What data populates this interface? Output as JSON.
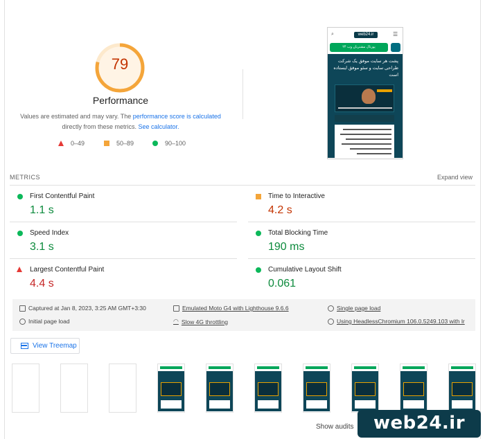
{
  "summary": {
    "score": "79",
    "title": "Performance",
    "desc_part1": "Values are estimated and may vary. The ",
    "desc_link1": "performance score is calculated",
    "desc_part2": " directly from these metrics. ",
    "desc_link2": "See calculator.",
    "score_fraction": 0.79,
    "legend": [
      {
        "shape": "triangle",
        "range": "0–49",
        "color": "#e53935"
      },
      {
        "shape": "square",
        "range": "50–89",
        "color": "#f4a53a"
      },
      {
        "shape": "circle",
        "range": "90–100",
        "color": "#0cb85a"
      }
    ]
  },
  "screenshot": {
    "logo": "web24.ir",
    "button_text": "پورتال مشتریان وب ۲۴",
    "hero_text": "پشت هر سایت موفق یک شرکت طراحی سایت و سئو موفق ایستاده است"
  },
  "metrics": {
    "label": "METRICS",
    "expand": "Expand view",
    "items": [
      {
        "name": "First Contentful Paint",
        "value": "1.1 s",
        "status": "pass"
      },
      {
        "name": "Time to Interactive",
        "value": "4.2 s",
        "status": "average"
      },
      {
        "name": "Speed Index",
        "value": "3.1 s",
        "status": "pass"
      },
      {
        "name": "Total Blocking Time",
        "value": "190 ms",
        "status": "pass"
      },
      {
        "name": "Largest Contentful Paint",
        "value": "4.4 s",
        "status": "fail"
      },
      {
        "name": "Cumulative Layout Shift",
        "value": "0.061",
        "status": "pass"
      }
    ]
  },
  "info": {
    "captured": "Captured at Jan 8, 2023, 3:25 AM GMT+3:30",
    "device": "Emulated Moto G4 with Lighthouse 9.6.6",
    "single": "Single page load",
    "initial": "Initial page load",
    "throttling": "Slow 4G throttling",
    "browser": "Using HeadlessChromium 106.0.5249.103 with lr"
  },
  "treemap": {
    "label": "View Treemap"
  },
  "filmstrip": {
    "blank_frames": 3,
    "content_frames": 7
  },
  "footer": {
    "show_audits": "Show audits"
  },
  "watermark": {
    "text": "web24.ir"
  },
  "colors": {
    "pass": "#0cb85a",
    "average": "#f4a53a",
    "fail": "#e53935",
    "link": "#1a73e8",
    "brand": "#0d3b4a"
  }
}
